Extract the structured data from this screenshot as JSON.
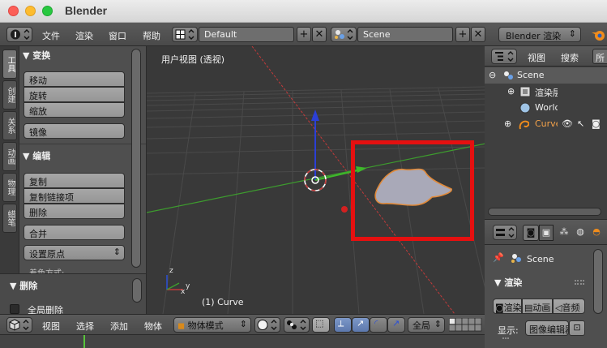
{
  "window": {
    "title": "Blender"
  },
  "info_header": {
    "menus": [
      "文件",
      "渲染",
      "窗口",
      "帮助"
    ],
    "screen_layout": "Default",
    "scene": "Scene",
    "render_engine": "Blender 渲染"
  },
  "tool_shelf": {
    "tabs": [
      "工具",
      "创建",
      "关系",
      "动画",
      "物理",
      "蜡笔"
    ],
    "transform_panel": {
      "title": "变换",
      "buttons": [
        "移动",
        "旋转",
        "缩放",
        "镜像"
      ]
    },
    "edit_panel": {
      "title": "编辑",
      "buttons": [
        "复制",
        "复制链接项",
        "删除",
        "合并"
      ],
      "set_origin": "设置原点",
      "cut_text": "着色方式:"
    },
    "delete_panel": {
      "title": "删除",
      "checkbox_label": "全局删除"
    }
  },
  "viewport": {
    "view_label": "用户视图 (透视)",
    "object_label": "(1) Curve",
    "axes": [
      "x",
      "y",
      "z"
    ]
  },
  "viewport_header": {
    "menus": [
      "视图",
      "选择",
      "添加",
      "物体"
    ],
    "mode": "物体模式",
    "orientation": "全局"
  },
  "outliner": {
    "header_menus": [
      "视图",
      "搜索",
      "所"
    ],
    "items": [
      {
        "label": "Scene",
        "icon": "scene-icon"
      },
      {
        "label": "渲染层",
        "icon": "render-layers-icon"
      },
      {
        "label": "World",
        "icon": "world-icon"
      },
      {
        "label": "Curve",
        "icon": "curve-icon"
      }
    ]
  },
  "properties": {
    "context_label": "Scene",
    "render_panel_title": "渲染",
    "render_buttons": [
      "渲染",
      "动画",
      "音频"
    ],
    "display_label": "显示:",
    "display_value": "图像编辑器"
  },
  "colors": {
    "highlight_box": "#e51010",
    "curve_fill": "#a9a9b8",
    "curve_outline": "#e08a3a",
    "x_axis": "#c23a3a",
    "y_axis": "#4fa33a",
    "z_axis": "#2b4fd6"
  }
}
